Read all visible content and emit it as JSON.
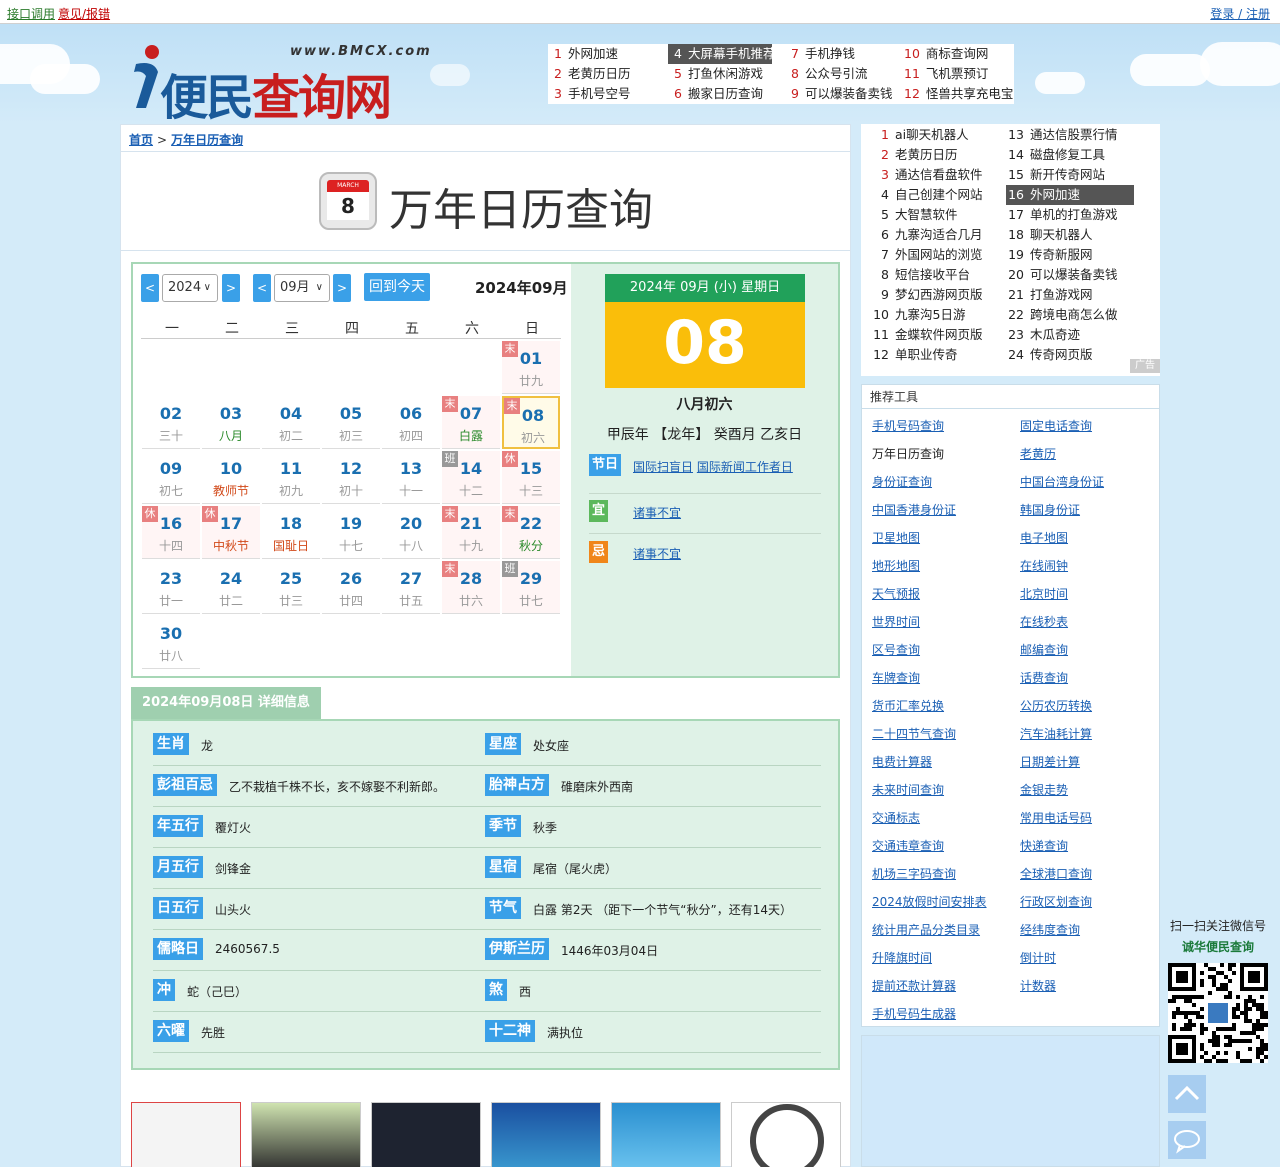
{
  "topbar": {
    "api": "接口调用",
    "feedback": "意见/报错",
    "login": "登录 / 注册"
  },
  "logo": {
    "url": "www.BMCX.com",
    "name_a": "便民",
    "name_b": "查询网"
  },
  "top_links": [
    {
      "n": "1",
      "t": "外网加速"
    },
    {
      "n": "2",
      "t": "老黄历日历"
    },
    {
      "n": "3",
      "t": "手机号空号"
    },
    {
      "n": "4",
      "t": "大屏幕手机推荐"
    },
    {
      "n": "5",
      "t": "打鱼休闲游戏"
    },
    {
      "n": "6",
      "t": "搬家日历查询"
    },
    {
      "n": "7",
      "t": "手机挣钱"
    },
    {
      "n": "8",
      "t": "公众号引流"
    },
    {
      "n": "9",
      "t": "可以爆装备卖钱"
    },
    {
      "n": "10",
      "t": "商标查询网"
    },
    {
      "n": "11",
      "t": "飞机票预订"
    },
    {
      "n": "12",
      "t": "怪兽共享充电宝"
    }
  ],
  "breadcrumb": {
    "home": "首页",
    "sep": ">",
    "current": "万年日历查询"
  },
  "page": {
    "icon_month": "MARCH",
    "icon_day": "8",
    "title": "万年日历查询"
  },
  "controls": {
    "prev": "<",
    "next": ">",
    "year": "2024",
    "month": "09月",
    "today": "回到今天",
    "header": "2024年09月"
  },
  "weekdays": [
    "一",
    "二",
    "三",
    "四",
    "五",
    "六",
    "日"
  ],
  "days": [
    {
      "d": "01",
      "l": "廿九",
      "tag": "末",
      "col": 6,
      "row": 0
    },
    {
      "d": "02",
      "l": "三十",
      "col": 0,
      "row": 1
    },
    {
      "d": "03",
      "l": "八月",
      "col": 1,
      "row": 1,
      "lc": "term"
    },
    {
      "d": "04",
      "l": "初二",
      "col": 2,
      "row": 1
    },
    {
      "d": "05",
      "l": "初三",
      "col": 3,
      "row": 1
    },
    {
      "d": "06",
      "l": "初四",
      "col": 4,
      "row": 1
    },
    {
      "d": "07",
      "l": "白露",
      "tag": "末",
      "col": 5,
      "row": 1,
      "lc": "term"
    },
    {
      "d": "08",
      "l": "初六",
      "tag": "末",
      "col": 6,
      "row": 1,
      "today": true
    },
    {
      "d": "09",
      "l": "初七",
      "col": 0,
      "row": 2
    },
    {
      "d": "10",
      "l": "教师节",
      "col": 1,
      "row": 2,
      "lc": "fest"
    },
    {
      "d": "11",
      "l": "初九",
      "col": 2,
      "row": 2
    },
    {
      "d": "12",
      "l": "初十",
      "col": 3,
      "row": 2
    },
    {
      "d": "13",
      "l": "十一",
      "col": 4,
      "row": 2
    },
    {
      "d": "14",
      "l": "十二",
      "tag": "班",
      "col": 5,
      "row": 2
    },
    {
      "d": "15",
      "l": "十三",
      "tag": "休",
      "col": 6,
      "row": 2
    },
    {
      "d": "16",
      "l": "十四",
      "tag": "休",
      "col": 0,
      "row": 3
    },
    {
      "d": "17",
      "l": "中秋节",
      "tag": "休",
      "col": 1,
      "row": 3,
      "lc": "fest"
    },
    {
      "d": "18",
      "l": "国耻日",
      "col": 2,
      "row": 3,
      "lc": "fest"
    },
    {
      "d": "19",
      "l": "十七",
      "col": 3,
      "row": 3
    },
    {
      "d": "20",
      "l": "十八",
      "col": 4,
      "row": 3
    },
    {
      "d": "21",
      "l": "十九",
      "tag": "末",
      "col": 5,
      "row": 3
    },
    {
      "d": "22",
      "l": "秋分",
      "tag": "末",
      "col": 6,
      "row": 3,
      "lc": "term"
    },
    {
      "d": "23",
      "l": "廿一",
      "col": 0,
      "row": 4
    },
    {
      "d": "24",
      "l": "廿二",
      "col": 1,
      "row": 4
    },
    {
      "d": "25",
      "l": "廿三",
      "col": 2,
      "row": 4
    },
    {
      "d": "26",
      "l": "廿四",
      "col": 3,
      "row": 4
    },
    {
      "d": "27",
      "l": "廿五",
      "col": 4,
      "row": 4
    },
    {
      "d": "28",
      "l": "廿六",
      "tag": "末",
      "col": 5,
      "row": 4
    },
    {
      "d": "29",
      "l": "廿七",
      "tag": "班",
      "col": 6,
      "row": 4
    },
    {
      "d": "30",
      "l": "廿八",
      "col": 0,
      "row": 5
    }
  ],
  "big": {
    "header": "2024年 09月 (小) 星期日",
    "day": "08",
    "lunar": "八月初六",
    "ganzhi": "甲辰年 【龙年】 癸酉月 乙亥日"
  },
  "festival": {
    "label": "节日",
    "items": [
      "国际扫盲日",
      "国际新闻工作者日"
    ]
  },
  "yi": {
    "label": "宜",
    "value": "诸事不宜"
  },
  "ji": {
    "label": "忌",
    "value": "诸事不宜"
  },
  "detail": {
    "tab": "2024年09月08日 详细信息",
    "left": [
      {
        "k": "生肖",
        "v": "龙"
      },
      {
        "k": "彭祖百忌",
        "v": "乙不栽植千株不长，亥不嫁娶不利新郎。"
      },
      {
        "k": "年五行",
        "v": "覆灯火"
      },
      {
        "k": "月五行",
        "v": "剑锋金"
      },
      {
        "k": "日五行",
        "v": "山头火"
      },
      {
        "k": "儒略日",
        "v": "2460567.5"
      },
      {
        "k": "冲",
        "v": "蛇（己巳）"
      },
      {
        "k": "六曜",
        "v": "先胜"
      }
    ],
    "right": [
      {
        "k": "星座",
        "v": "处女座"
      },
      {
        "k": "胎神占方",
        "v": "碓磨床外西南"
      },
      {
        "k": "季节",
        "v": "秋季"
      },
      {
        "k": "星宿",
        "v": "尾宿（尾火虎）"
      },
      {
        "k": "节气",
        "v": "白露 第2天 （距下一个节气“秋分”，还有14天）"
      },
      {
        "k": "伊斯兰历",
        "v": "1446年03月04日"
      },
      {
        "k": "煞",
        "v": "西"
      },
      {
        "k": "十二神",
        "v": "满执位"
      }
    ]
  },
  "side_ads": [
    {
      "n": "1",
      "t": "ai聊天机器人"
    },
    {
      "n": "2",
      "t": "老黄历日历"
    },
    {
      "n": "3",
      "t": "通达信看盘软件"
    },
    {
      "n": "4",
      "t": "自己创建个网站"
    },
    {
      "n": "5",
      "t": "大智慧软件"
    },
    {
      "n": "6",
      "t": "九寨沟适合几月"
    },
    {
      "n": "7",
      "t": "外国网站的浏览"
    },
    {
      "n": "8",
      "t": "短信接收平台"
    },
    {
      "n": "9",
      "t": "梦幻西游网页版"
    },
    {
      "n": "10",
      "t": "九寨沟5日游"
    },
    {
      "n": "11",
      "t": "金蝶软件网页版"
    },
    {
      "n": "12",
      "t": "单职业传奇"
    },
    {
      "n": "13",
      "t": "通达信股票行情"
    },
    {
      "n": "14",
      "t": "磁盘修复工具"
    },
    {
      "n": "15",
      "t": "新开传奇网站"
    },
    {
      "n": "16",
      "t": "外网加速"
    },
    {
      "n": "17",
      "t": "单机的打鱼游戏"
    },
    {
      "n": "18",
      "t": "聊天机器人"
    },
    {
      "n": "19",
      "t": "传奇新服网"
    },
    {
      "n": "20",
      "t": "可以爆装备卖钱"
    },
    {
      "n": "21",
      "t": "打鱼游戏网"
    },
    {
      "n": "22",
      "t": "跨境电商怎么做"
    },
    {
      "n": "23",
      "t": "木瓜奇迹"
    },
    {
      "n": "24",
      "t": "传奇网页版"
    }
  ],
  "ad_label": "广告",
  "tools": {
    "header": "推荐工具",
    "left": [
      "手机号码查询",
      "万年日历查询",
      "身份证查询",
      "中国香港身份证",
      "卫星地图",
      "地形地图",
      "天气预报",
      "世界时间",
      "区号查询",
      "车牌查询",
      "货币汇率兑换",
      "二十四节气查询",
      "电费计算器",
      "未来时间查询",
      "交通标志",
      "交通违章查询",
      "机场三字码查询",
      "2024放假时间安排表",
      "统计用产品分类目录",
      "升降旗时间",
      "提前还款计算器",
      "手机号码生成器"
    ],
    "right": [
      "固定电话查询",
      "老黄历",
      "中国台湾身份证",
      "韩国身份证",
      "电子地图",
      "在线闹钟",
      "北京时间",
      "在线秒表",
      "邮编查询",
      "话费查询",
      "公历农历转换",
      "汽车油耗计算",
      "日期差计算",
      "金银走势",
      "常用电话号码",
      "快递查询",
      "全球港口查询",
      "行政区划查询",
      "经纬度查询",
      "倒计时",
      "计数器"
    ]
  },
  "qr": {
    "line1": "扫一扫关注微信号",
    "line2": "诚华便民查询"
  }
}
